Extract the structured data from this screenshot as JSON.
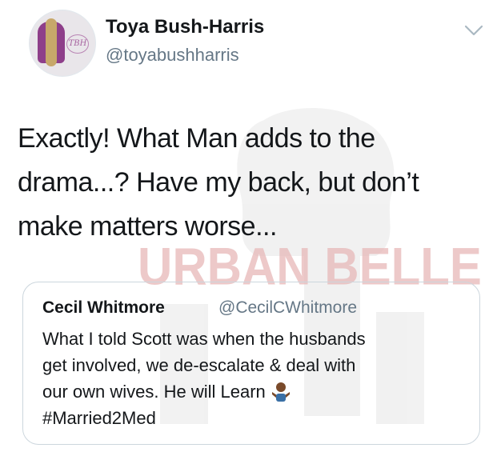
{
  "tweet": {
    "author": {
      "display_name": "Toya Bush-Harris",
      "handle": "@toyabushharris"
    },
    "text_lines": [
      "Exactly! What Man adds to the",
      "drama...? Have my back, but don’t",
      "make matters worse..."
    ],
    "menu_icon": "chevron-down-icon"
  },
  "watermark": {
    "text": "URBAN BELLE",
    "color": "#e7b8b8"
  },
  "quoted_tweet": {
    "display_name": "Cecil Whitmore",
    "handle": "@CecilCWhitmore",
    "text_lines": [
      "What I told Scott was when the husbands",
      "get involved, we de-escalate & deal with",
      "our own wives.  He will Learn",
      "#Married2Med"
    ],
    "emoji": "person-shrugging-emoji"
  },
  "colors": {
    "text": "#14171a",
    "secondary": "#657786",
    "border": "#ccd6dd"
  }
}
